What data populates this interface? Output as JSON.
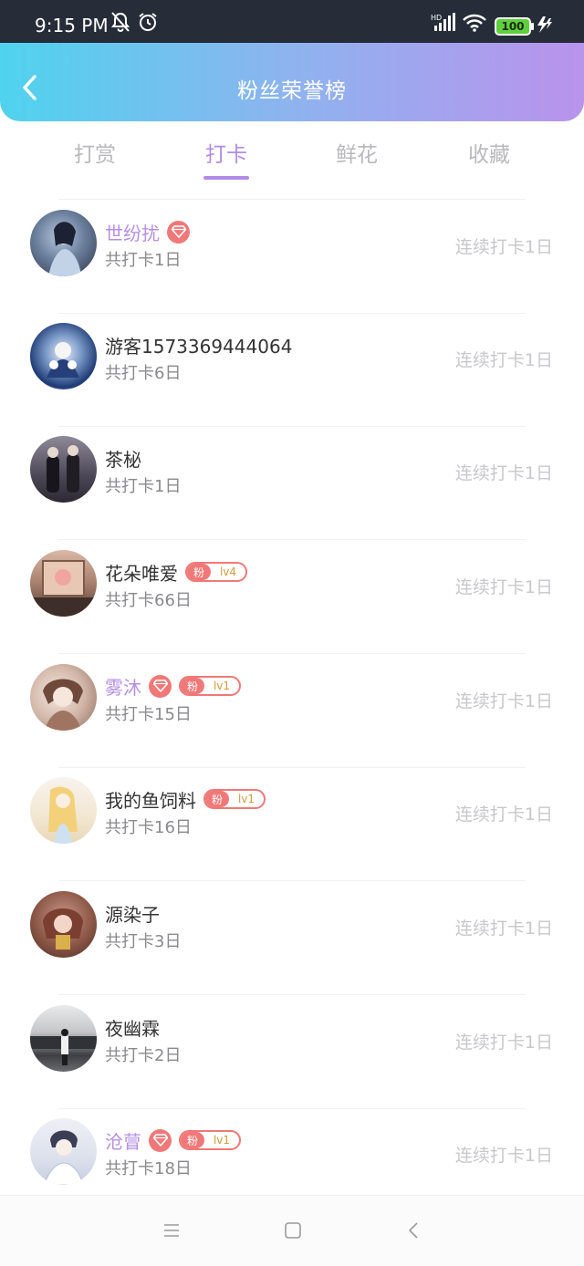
{
  "status_bar": {
    "time": "9:15 PM",
    "battery": "100",
    "icons": [
      "bell-off-icon",
      "alarm-icon",
      "hd-signal-icon",
      "wifi-icon",
      "battery-icon",
      "charging-icon"
    ]
  },
  "header": {
    "title": "粉丝荣誉榜",
    "back_icon": "chevron-left-icon",
    "gradient": [
      "#4fd3ee",
      "#b993ec"
    ]
  },
  "tabs": [
    {
      "label": "打赏",
      "active": false
    },
    {
      "label": "打卡",
      "active": true
    },
    {
      "label": "鲜花",
      "active": false
    },
    {
      "label": "收藏",
      "active": false
    }
  ],
  "accent_color": "#b18ce6",
  "fans": [
    {
      "name": "世纷扰",
      "vip": true,
      "diamond": true,
      "badge": null,
      "total": "共打卡1日",
      "streak": "连续打卡1日"
    },
    {
      "name": "游客1573369444064",
      "vip": false,
      "diamond": false,
      "badge": null,
      "total": "共打卡6日",
      "streak": "连续打卡1日"
    },
    {
      "name": "茶柲",
      "vip": false,
      "diamond": false,
      "badge": null,
      "total": "共打卡1日",
      "streak": "连续打卡1日"
    },
    {
      "name": "花朵唯爱",
      "vip": false,
      "diamond": false,
      "badge": {
        "char": "粉",
        "level": "lv4"
      },
      "total": "共打卡66日",
      "streak": "连续打卡1日"
    },
    {
      "name": "雾沐",
      "vip": true,
      "diamond": true,
      "badge": {
        "char": "粉",
        "level": "lv1"
      },
      "total": "共打卡15日",
      "streak": "连续打卡1日"
    },
    {
      "name": "我的鱼饲料",
      "vip": false,
      "diamond": false,
      "badge": {
        "char": "粉",
        "level": "lv1"
      },
      "total": "共打卡16日",
      "streak": "连续打卡1日"
    },
    {
      "name": "源染子",
      "vip": false,
      "diamond": false,
      "badge": null,
      "total": "共打卡3日",
      "streak": "连续打卡1日"
    },
    {
      "name": "夜幽霖",
      "vip": false,
      "diamond": false,
      "badge": null,
      "total": "共打卡2日",
      "streak": "连续打卡1日"
    },
    {
      "name": "沧萺",
      "vip": true,
      "diamond": true,
      "badge": {
        "char": "粉",
        "level": "lv1"
      },
      "total": "共打卡18日",
      "streak": "连续打卡1日"
    }
  ],
  "nav": {
    "buttons": [
      "menu-icon",
      "home-square-icon",
      "back-triangle-icon"
    ]
  }
}
